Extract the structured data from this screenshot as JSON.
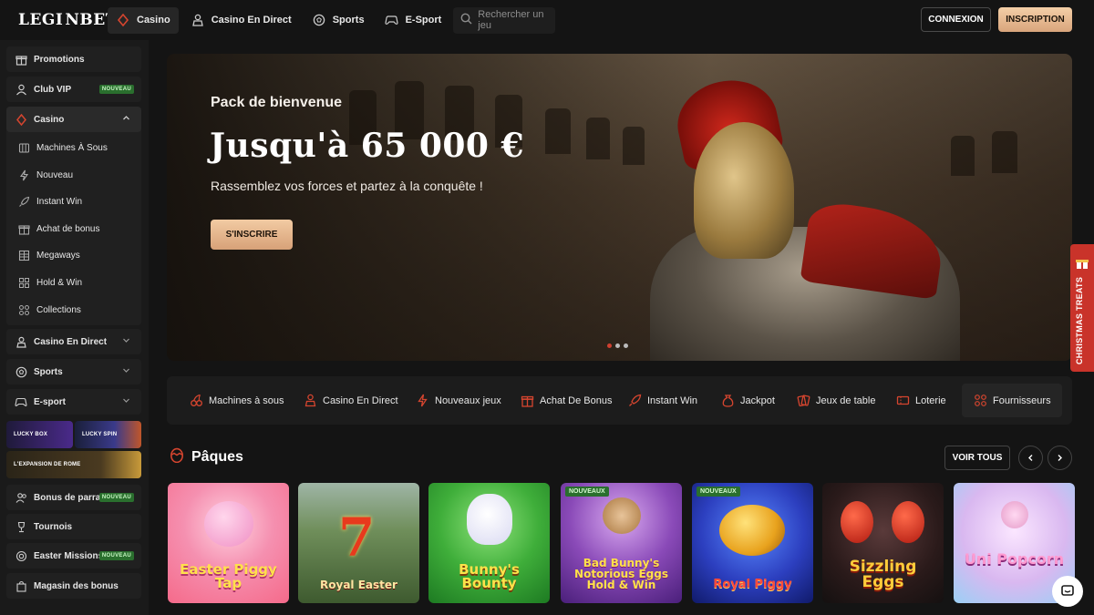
{
  "brand": {
    "logo_left": "LEGI",
    "logo_right": "NBET"
  },
  "nav": {
    "items": [
      {
        "label": "Casino",
        "icon": "casino-icon"
      },
      {
        "label": "Casino En Direct",
        "icon": "dealer-icon"
      },
      {
        "label": "Sports",
        "icon": "football-icon"
      },
      {
        "label": "E-Sport",
        "icon": "gamepad-icon"
      }
    ],
    "search_placeholder": "Rechercher un jeu",
    "login": "CONNEXION",
    "signup": "INSCRIPTION"
  },
  "sidebar": {
    "promotions": "Promotions",
    "club_vip": "Club VIP",
    "new_badge": "NOUVEAU",
    "casino": "Casino",
    "casino_sub": [
      "Machines À Sous",
      "Nouveau",
      "Instant Win",
      "Achat de bonus",
      "Megaways",
      "Hold & Win",
      "Collections"
    ],
    "casino_live": "Casino En Direct",
    "sports": "Sports",
    "esport": "E-sport",
    "lucky_box": "LUCKY BOX",
    "lucky_spin": "LUCKY SPIN",
    "expansion": "L'EXPANSION DE ROME",
    "referral": "Bonus de parrai...",
    "tournaments": "Tournois",
    "easter_missions": "Easter Missions",
    "bonus_shop": "Magasin des bonus"
  },
  "hero": {
    "subtitle": "Pack de bienvenue",
    "title": "Jusqu'à 65 000 €",
    "description": "Rassemblez vos forces et partez à la conquête !",
    "cta": "S'INSCRIRE",
    "slides": 3,
    "active_slide": 1
  },
  "side_tab": {
    "label": "CHRISTMAS TREATS"
  },
  "categories": [
    {
      "label": "Machines à sous",
      "icon": "cherries-icon"
    },
    {
      "label": "Casino En Direct",
      "icon": "dealer-icon"
    },
    {
      "label": "Nouveaux jeux",
      "icon": "lightning-icon"
    },
    {
      "label": "Achat De Bonus",
      "icon": "gift-icon"
    },
    {
      "label": "Instant Win",
      "icon": "rocket-icon"
    },
    {
      "label": "Jackpot",
      "icon": "money-bag-icon"
    },
    {
      "label": "Jeux de table",
      "icon": "cards-icon"
    },
    {
      "label": "Loterie",
      "icon": "ticket-icon"
    },
    {
      "label": "Fournisseurs",
      "icon": "grid-icon"
    }
  ],
  "section": {
    "title": "Pâques",
    "icon": "easter-egg-icon",
    "see_all": "VOIR TOUS"
  },
  "games": [
    {
      "name": "Easter Piggy Tap",
      "badge": "",
      "bg": "#f58aa3"
    },
    {
      "name": "Royal Easter",
      "badge": "",
      "bg": "#5e7f47"
    },
    {
      "name": "Bunny's Bounty",
      "badge": "",
      "bg": "#3fae3a"
    },
    {
      "name": "Bad Bunny's Notorious Eggs Hold & Win",
      "badge": "NOUVEAUX",
      "bg": "#7a4aa8"
    },
    {
      "name": "Royal Piggy",
      "badge": "NOUVEAUX",
      "bg": "#2c3fbf"
    },
    {
      "name": "Sizzling Eggs",
      "badge": "",
      "bg": "#3a2a2a"
    },
    {
      "name": "Uni Popcorn",
      "badge": "",
      "bg": "#d9b8f0"
    }
  ],
  "colors": {
    "accent": "#e0aa7e",
    "danger": "#c9332a",
    "badge_green": "#2a6f2e"
  }
}
